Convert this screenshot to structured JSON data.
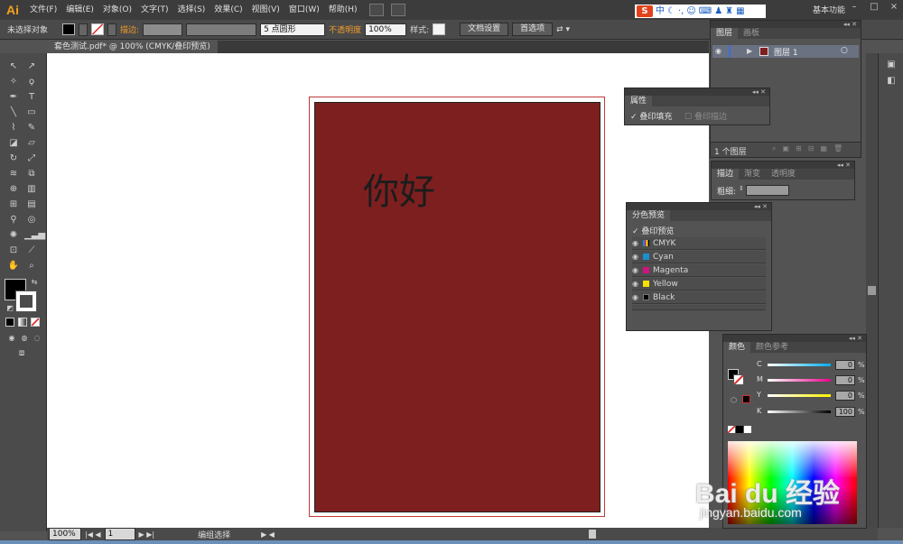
{
  "app": {
    "logo": "Ai",
    "workspace": "基本功能"
  },
  "menu": [
    "文件(F)",
    "编辑(E)",
    "对象(O)",
    "文字(T)",
    "选择(S)",
    "效果(C)",
    "视图(V)",
    "窗口(W)",
    "帮助(H)"
  ],
  "ime": {
    "logo": "S",
    "label": "中"
  },
  "control": {
    "selection": "未选择对象",
    "stroke_label": "描边:",
    "brush_value": "5 点圆形",
    "opacity_label": "不透明度",
    "opacity_value": "100%",
    "style_label": "样式:",
    "doc_setup": "文档设置",
    "preferences": "首选项"
  },
  "document": {
    "tab": "套色测试.pdf* @ 100% (CMYK/叠印预览)",
    "text": "你好",
    "art_color": "#7e1f1f"
  },
  "status": {
    "zoom": "100%",
    "page": "1",
    "selection_mode": "编组选择"
  },
  "layers_panel": {
    "tabs": [
      "图层",
      "画板"
    ],
    "layer_name": "图层 1",
    "count": "1 个图层"
  },
  "attributes_panel": {
    "tab": "属性",
    "overprint_fill": "叠印填充",
    "overprint_stroke": "叠印描边"
  },
  "stroke_panel": {
    "tabs": [
      "描边",
      "渐变",
      "透明度"
    ],
    "weight_label": "粗细:"
  },
  "separations_panel": {
    "tab": "分色预览",
    "overprint_preview": "叠印预览",
    "inks": [
      {
        "name": "CMYK",
        "color": "#ffffff"
      },
      {
        "name": "Cyan",
        "color": "#1a8fd0"
      },
      {
        "name": "Magenta",
        "color": "#d0147f"
      },
      {
        "name": "Yellow",
        "color": "#f5e000"
      },
      {
        "name": "Black",
        "color": "#000000"
      }
    ]
  },
  "color_panel": {
    "tabs": [
      "颜色",
      "颜色参考"
    ],
    "channels": [
      {
        "name": "C",
        "value": "0",
        "unit": "%"
      },
      {
        "name": "M",
        "value": "0",
        "unit": "%"
      },
      {
        "name": "Y",
        "value": "0",
        "unit": "%"
      },
      {
        "name": "K",
        "value": "100",
        "unit": "%"
      }
    ]
  },
  "watermark": {
    "brand": "Bai du 经验",
    "url": "jingyan.baidu.com"
  }
}
